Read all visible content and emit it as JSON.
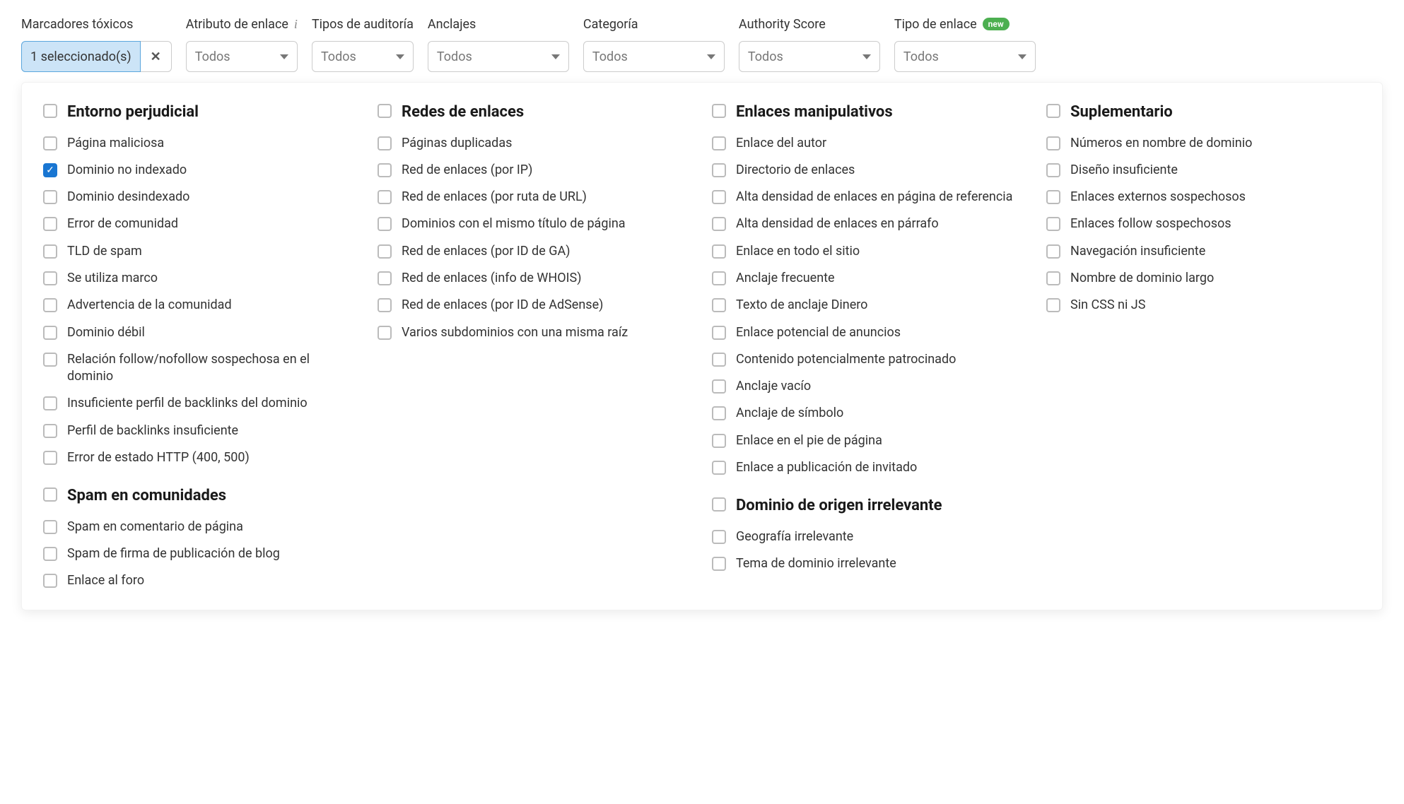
{
  "filters": {
    "toxic_markers": {
      "label": "Marcadores tóxicos",
      "value": "1 seleccionado(s)"
    },
    "link_attribute": {
      "label": "Atributo de enlace",
      "value": "Todos"
    },
    "audit_types": {
      "label": "Tipos de auditoría",
      "value": "Todos"
    },
    "anchors": {
      "label": "Anclajes",
      "value": "Todos"
    },
    "category": {
      "label": "Categoría",
      "value": "Todos"
    },
    "authority_score": {
      "label": "Authority Score",
      "value": "Todos"
    },
    "link_type": {
      "label": "Tipo de enlace",
      "value": "Todos",
      "badge": "new"
    }
  },
  "columns": [
    {
      "sections": [
        {
          "key": "harmful-env",
          "title": "Entorno perjudicial",
          "items": [
            {
              "label": "Página maliciosa",
              "checked": false
            },
            {
              "label": "Dominio no indexado",
              "checked": true
            },
            {
              "label": "Dominio desindexado",
              "checked": false
            },
            {
              "label": "Error de comunidad",
              "checked": false
            },
            {
              "label": "TLD de spam",
              "checked": false
            },
            {
              "label": "Se utiliza marco",
              "checked": false
            },
            {
              "label": "Advertencia de la comunidad",
              "checked": false
            },
            {
              "label": "Dominio débil",
              "checked": false
            },
            {
              "label": "Relación follow/nofollow sospechosa en el dominio",
              "checked": false
            },
            {
              "label": "Insuficiente perfil de backlinks del dominio",
              "checked": false
            },
            {
              "label": "Perfil de backlinks insuficiente",
              "checked": false
            },
            {
              "label": "Error de estado HTTP (400, 500)",
              "checked": false
            }
          ]
        },
        {
          "key": "community-spam",
          "title": "Spam en comunidades",
          "items": [
            {
              "label": "Spam en comentario de página",
              "checked": false
            },
            {
              "label": "Spam de firma de publicación de blog",
              "checked": false
            },
            {
              "label": "Enlace al foro",
              "checked": false
            }
          ]
        }
      ]
    },
    {
      "sections": [
        {
          "key": "link-networks",
          "title": "Redes de enlaces",
          "items": [
            {
              "label": "Páginas duplicadas",
              "checked": false
            },
            {
              "label": "Red de enlaces (por IP)",
              "checked": false
            },
            {
              "label": "Red de enlaces (por ruta de URL)",
              "checked": false
            },
            {
              "label": "Dominios con el mismo título de página",
              "checked": false
            },
            {
              "label": "Red de enlaces (por ID de GA)",
              "checked": false
            },
            {
              "label": "Red de enlaces (info de WHOIS)",
              "checked": false
            },
            {
              "label": "Red de enlaces (por ID de AdSense)",
              "checked": false
            },
            {
              "label": "Varios subdominios con una misma raíz",
              "checked": false
            }
          ]
        }
      ]
    },
    {
      "sections": [
        {
          "key": "manipulative-links",
          "title": "Enlaces manipulativos",
          "items": [
            {
              "label": "Enlace del autor",
              "checked": false
            },
            {
              "label": "Directorio de enlaces",
              "checked": false
            },
            {
              "label": "Alta densidad de enlaces en página de referencia",
              "checked": false
            },
            {
              "label": "Alta densidad de enlaces en párrafo",
              "checked": false
            },
            {
              "label": "Enlace en todo el sitio",
              "checked": false
            },
            {
              "label": "Anclaje frecuente",
              "checked": false
            },
            {
              "label": "Texto de anclaje Dinero",
              "checked": false
            },
            {
              "label": "Enlace potencial de anuncios",
              "checked": false
            },
            {
              "label": "Contenido potencialmente patrocinado",
              "checked": false
            },
            {
              "label": "Anclaje vacío",
              "checked": false
            },
            {
              "label": "Anclaje de símbolo",
              "checked": false
            },
            {
              "label": "Enlace en el pie de página",
              "checked": false
            },
            {
              "label": "Enlace a publicación de invitado",
              "checked": false
            }
          ]
        },
        {
          "key": "irrelevant-origin",
          "title": "Dominio de origen irrelevante",
          "items": [
            {
              "label": "Geografía irrelevante",
              "checked": false
            },
            {
              "label": "Tema de dominio irrelevante",
              "checked": false
            }
          ]
        }
      ]
    },
    {
      "sections": [
        {
          "key": "supplementary",
          "title": "Suplementario",
          "items": [
            {
              "label": "Números en nombre de dominio",
              "checked": false
            },
            {
              "label": "Diseño insuficiente",
              "checked": false
            },
            {
              "label": "Enlaces externos sospechosos",
              "checked": false
            },
            {
              "label": "Enlaces follow sospechosos",
              "checked": false
            },
            {
              "label": "Navegación insuficiente",
              "checked": false
            },
            {
              "label": "Nombre de dominio largo",
              "checked": false
            },
            {
              "label": "Sin CSS ni JS",
              "checked": false
            }
          ]
        }
      ]
    }
  ]
}
